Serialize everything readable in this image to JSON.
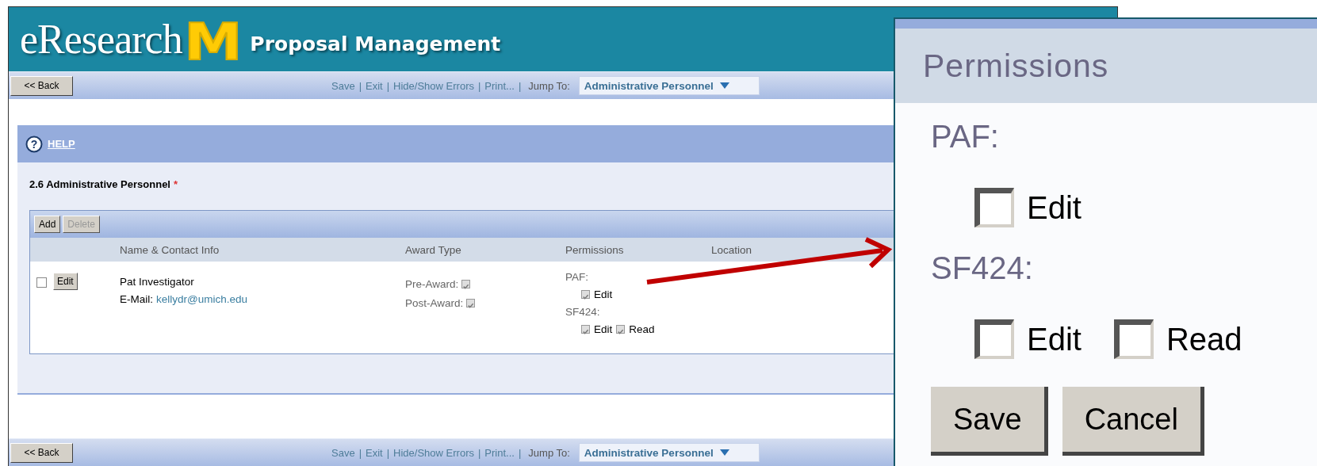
{
  "header": {
    "brand": "eResearch",
    "logo_mark": "M",
    "title": "Proposal Management"
  },
  "top_toolbar": {
    "back": "<< Back",
    "links": [
      "Save",
      "Exit",
      "Hide/Show Errors",
      "Print..."
    ],
    "separator": "|",
    "jump_label": "Jump To:",
    "jump_value": "Administrative Personnel"
  },
  "bottom_toolbar": {
    "back": "<< Back",
    "links": [
      "Save",
      "Exit",
      "Hide/Show Errors",
      "Print..."
    ],
    "separator": "|",
    "jump_label": "Jump To:",
    "jump_value": "Administrative Personnel"
  },
  "help": {
    "label": "HELP",
    "icon_char": "?"
  },
  "section": {
    "title": "2.6 Administrative Personnel",
    "required_mark": "*"
  },
  "table": {
    "buttons": [
      {
        "label": "Add",
        "disabled": false
      },
      {
        "label": "Delete",
        "disabled": true
      }
    ],
    "columns": [
      "Name & Contact Info",
      "Award Type",
      "Permissions",
      "Location"
    ],
    "rows": [
      {
        "checked": false,
        "edit": "Edit",
        "name": "Pat Investigator",
        "email_label": "E-Mail:",
        "email": "kellydr@umich.edu",
        "award": [
          {
            "label": "Pre-Award:",
            "checked": true
          },
          {
            "label": "Post-Award:",
            "checked": true
          }
        ],
        "permissions": [
          {
            "group": "PAF:",
            "options": [
              {
                "label": "Edit",
                "checked": true
              }
            ]
          },
          {
            "group": "SF424:",
            "options": [
              {
                "label": "Edit",
                "checked": true
              },
              {
                "label": "Read",
                "checked": true
              }
            ]
          }
        ]
      }
    ]
  },
  "popup": {
    "title": "Permissions",
    "groups": [
      {
        "group": "PAF:",
        "options": [
          {
            "label": "Edit",
            "checked": false
          }
        ]
      },
      {
        "group": "SF424:",
        "options": [
          {
            "label": "Edit",
            "checked": false
          },
          {
            "label": "Read",
            "checked": false
          }
        ]
      }
    ],
    "buttons": [
      "Save",
      "Cancel"
    ]
  }
}
